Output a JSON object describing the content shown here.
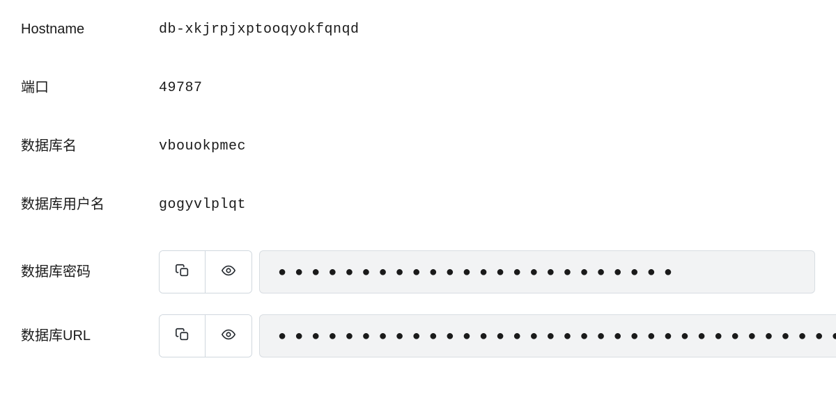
{
  "fields": {
    "hostname": {
      "label": "Hostname",
      "value": "db-xkjrpjxptooqyokfqnqd"
    },
    "port": {
      "label": "端口",
      "value": "49787"
    },
    "dbname": {
      "label": "数据库名",
      "value": "vbouokpmec"
    },
    "dbuser": {
      "label": "数据库用户名",
      "value": "gogyvlplqt"
    },
    "dbpass": {
      "label": "数据库密码",
      "masked": "●●●●●●●●●●●●●●●●●●●●●●●●"
    },
    "dburl": {
      "label": "数据库URL",
      "masked": "●●●●●●●●●●●●●●●●●●●●●●●●●●●●●●●●●●●●●●●●●●●●●●●●"
    }
  }
}
